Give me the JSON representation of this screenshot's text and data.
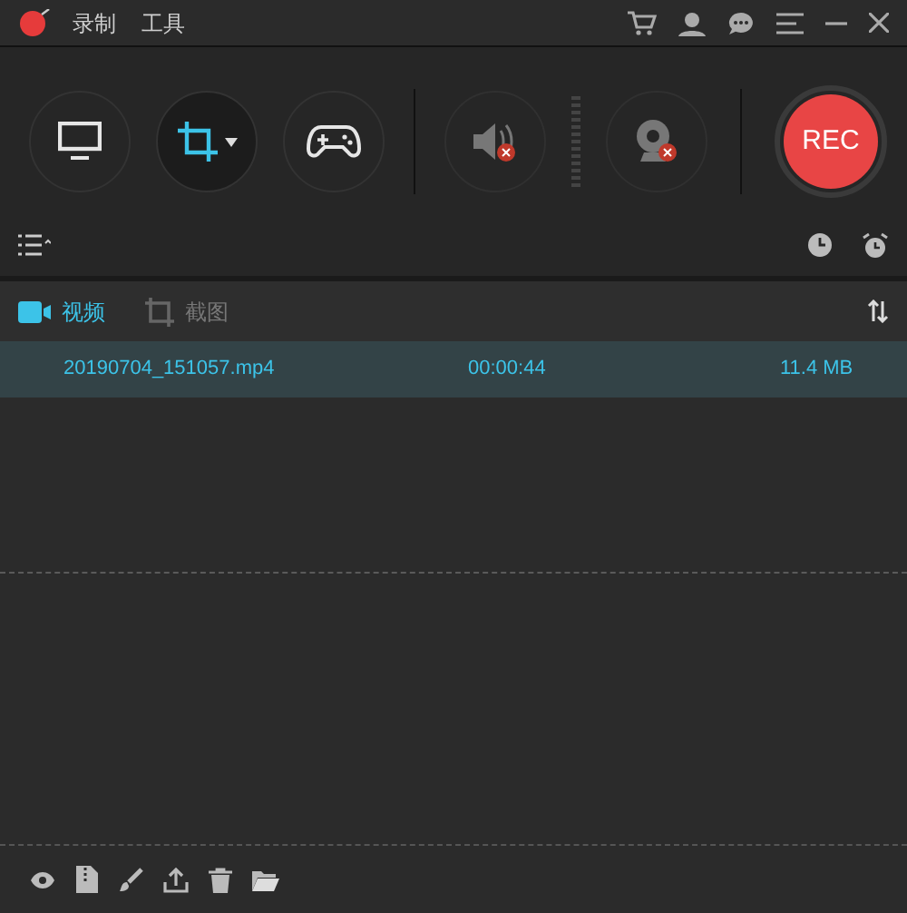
{
  "menu": [
    "录制",
    "工具"
  ],
  "record_button": {
    "label": "REC"
  },
  "sources": [
    {
      "kind": "screen",
      "selected": false
    },
    {
      "kind": "region",
      "selected": true
    },
    {
      "kind": "game",
      "selected": false
    }
  ],
  "audio": {
    "muted": true
  },
  "webcam": {
    "muted": true
  },
  "tabs": [
    {
      "label": "视频",
      "selected": true
    },
    {
      "label": "截图",
      "selected": false
    }
  ],
  "files": [
    {
      "name": "20190704_151057.mp4",
      "duration": "00:00:44",
      "size": "11.4 MB",
      "selected": true
    }
  ]
}
